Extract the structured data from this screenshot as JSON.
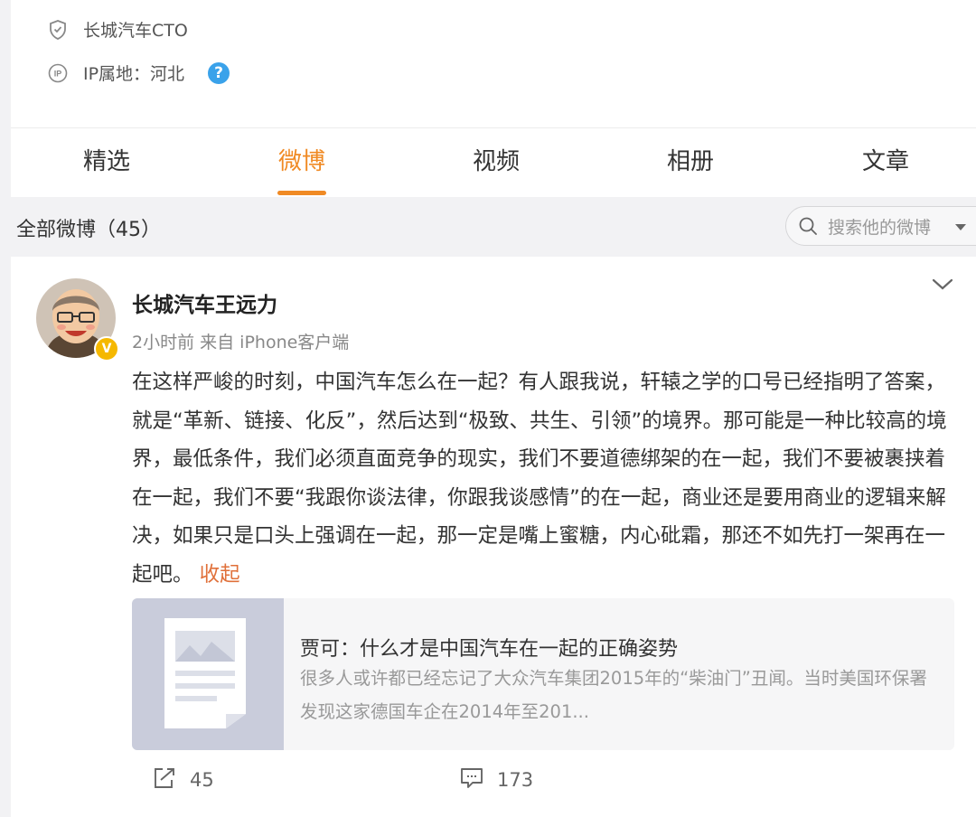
{
  "profile": {
    "verified_title": "长城汽车CTO",
    "ip_location": "IP属地：河北",
    "help_symbol": "?"
  },
  "tabs": [
    {
      "label": "精选",
      "active": false
    },
    {
      "label": "微博",
      "active": true
    },
    {
      "label": "视频",
      "active": false
    },
    {
      "label": "相册",
      "active": false
    },
    {
      "label": "文章",
      "active": false
    }
  ],
  "filter": {
    "title": "全部微博（45）",
    "search_placeholder": "搜索他的微博"
  },
  "post": {
    "author": "长城汽车王远力",
    "meta": "2小时前 来自 iPhone客户端",
    "verify_symbol": "V",
    "content": "在这样严峻的时刻，中国汽车怎么在一起？有人跟我说，轩辕之学的口号已经指明了答案，就是“革新、链接、化反”，然后达到“极致、共生、引领”的境界。那可能是一种比较高的境界，最低条件，我们必须直面竞争的现实，我们不要道德绑架的在一起，我们不要被裹挟着在一起，我们不要“我跟你谈法律，你跟我谈感情”的在一起，商业还是要用商业的逻辑来解决，如果只是口头上强调在一起，那一定是嘴上蜜糖，内心砒霜，那还不如先打一架再在一起吧。",
    "collapse_label": "收起",
    "link_card": {
      "title": "贾可：什么才是中国汽车在一起的正确姿势",
      "description": "很多人或许都已经忘记了大众汽车集团2015年的“柴油门”丑闻。当时美国环保署发现这家德国车企在2014年至201..."
    },
    "repost_count": "45",
    "comment_count": "173"
  },
  "colors": {
    "accent": "#f08a24",
    "collapse_link": "#e0703a",
    "help_badge": "#3aa2ea",
    "verify_badge": "#f5b800"
  },
  "icons": [
    "shield-icon",
    "ip-icon",
    "help-icon",
    "search-icon",
    "dropdown-caret-icon",
    "chevron-down-icon",
    "repost-icon",
    "comment-icon",
    "article-thumbnail-icon"
  ]
}
